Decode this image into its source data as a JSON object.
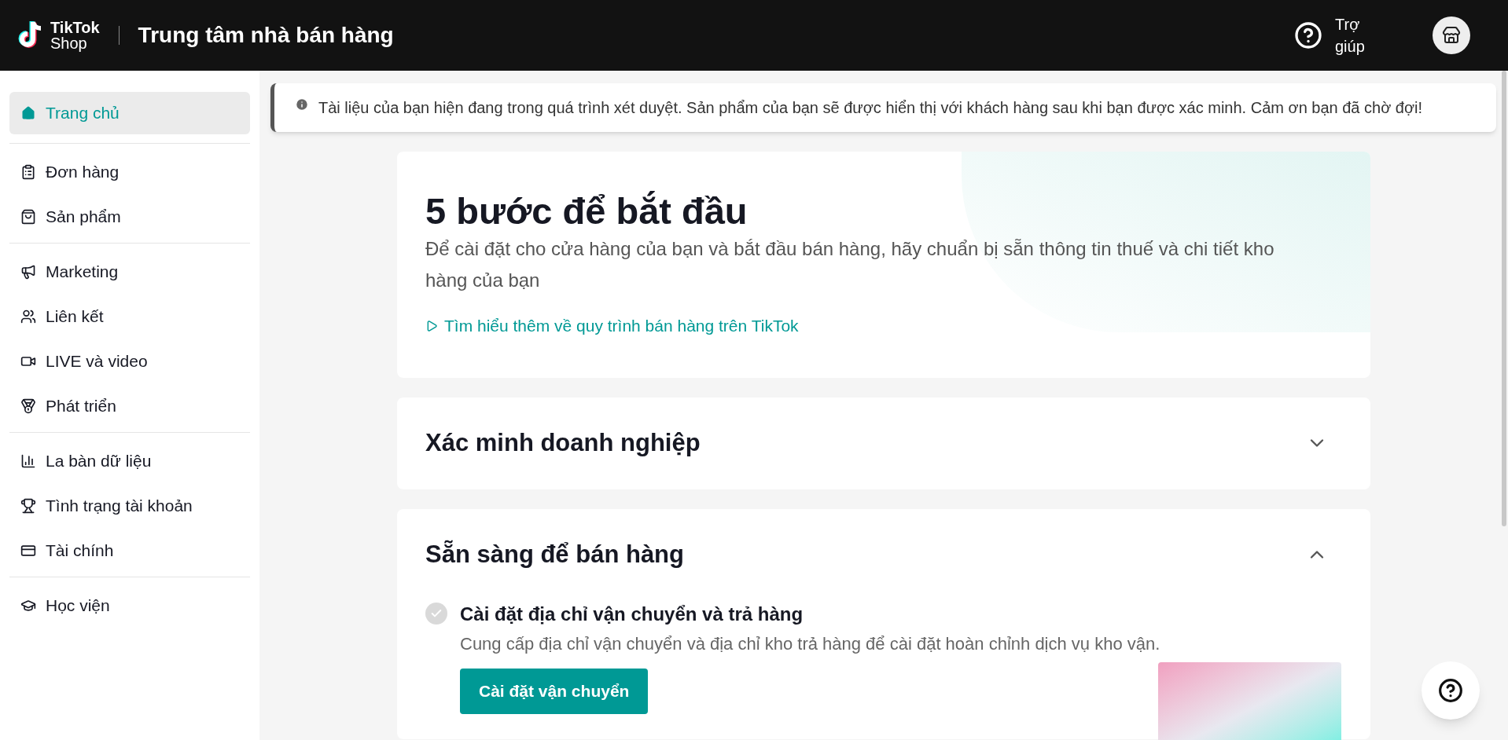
{
  "header": {
    "logo_top": "TikTok",
    "logo_bottom": "Shop",
    "title": "Trung tâm nhà bán hàng",
    "help": "Trợ giúp"
  },
  "sidebar": {
    "groups": [
      {
        "items": [
          {
            "label": "Trang chủ",
            "selected": true
          }
        ]
      },
      {
        "items": [
          {
            "label": "Đơn hàng",
            "selected": false
          },
          {
            "label": "Sản phẩm",
            "selected": false
          }
        ]
      },
      {
        "items": [
          {
            "label": "Marketing",
            "selected": false
          },
          {
            "label": "Liên kết",
            "selected": false
          },
          {
            "label": "LIVE và video",
            "selected": false
          },
          {
            "label": "Phát triển",
            "selected": false
          }
        ]
      },
      {
        "items": [
          {
            "label": "La bàn dữ liệu",
            "selected": false
          },
          {
            "label": "Tình trạng tài khoản",
            "selected": false
          },
          {
            "label": "Tài chính",
            "selected": false
          }
        ]
      },
      {
        "items": [
          {
            "label": "Học viện",
            "selected": false
          }
        ]
      }
    ]
  },
  "notice": {
    "text": "Tài liệu của bạn hiện đang trong quá trình xét duyệt. Sản phẩm của bạn sẽ được hiển thị với khách hàng sau khi bạn được xác minh. Cảm ơn bạn đã chờ đợi!"
  },
  "intro": {
    "title": "5 bước để bắt đầu",
    "subtitle": "Để cài đặt cho cửa hàng của bạn và bắt đầu bán hàng, hãy chuẩn bị sẵn thông tin thuế và chi tiết kho hàng của bạn",
    "link": "Tìm hiểu thêm về quy trình bán hàng trên TikTok"
  },
  "sections": [
    {
      "title": "Xác minh doanh nghiệp",
      "expanded": false
    },
    {
      "title": "Sẵn sàng để bán hàng",
      "expanded": true,
      "tasks": [
        {
          "title": "Cài đặt địa chỉ vận chuyển và trả hàng",
          "description": "Cung cấp địa chỉ vận chuyển và địa chỉ kho trả hàng để cài đặt hoàn chỉnh dịch vụ kho vận.",
          "done": true,
          "button": "Cài đặt vận chuyển"
        }
      ]
    }
  ]
}
